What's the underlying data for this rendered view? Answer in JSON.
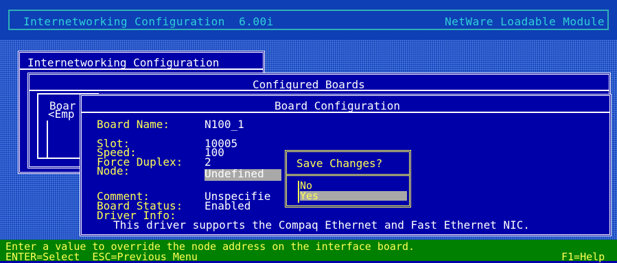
{
  "header": {
    "app_title": "Internetworking Configuration  6.00i",
    "module_label": "NetWare Loadable Module"
  },
  "windows": {
    "main_title": "Internetworking Configuration",
    "configured_boards_title": "Configured Boards",
    "boards_list_header": "Boar",
    "boards_list_empty": "<Emp",
    "board_config_title": "Board Configuration"
  },
  "board": {
    "name_label": "Board Name:",
    "name_value": "N100_1",
    "slot_label": "Slot:",
    "slot_value": "10005",
    "speed_label": "Speed:",
    "speed_value": "100",
    "duplex_label": "Force Duplex:",
    "duplex_value": "2",
    "node_label": "Node:",
    "node_value": "Undefined",
    "comment_label": "Comment:",
    "comment_value": "Unspecifie",
    "status_label": "Board Status:",
    "status_value": "Enabled",
    "driver_label": "Driver Info:",
    "driver_value": "This driver supports the Compaq Ethernet and Fast Ethernet NIC."
  },
  "dialog": {
    "title": "Save Changes?",
    "options": [
      "No",
      "Yes"
    ],
    "selected": "Yes"
  },
  "status": {
    "hint": "Enter a value to override the node address on the interface board.",
    "keys": "ENTER=Select  ESC=Previous Menu",
    "help": "F1=Help"
  }
}
